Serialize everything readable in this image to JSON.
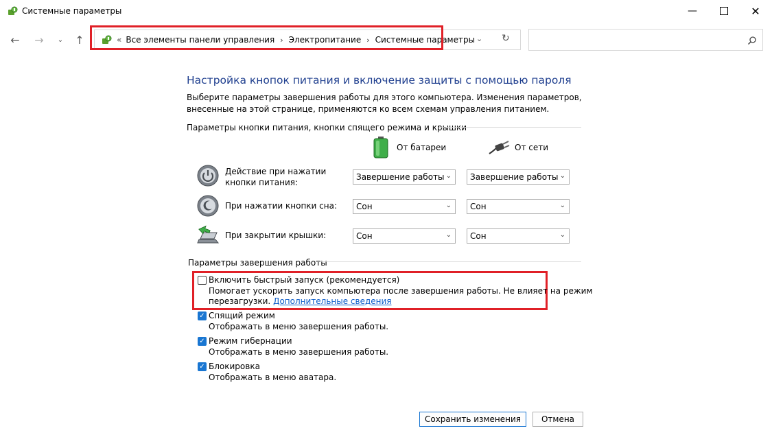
{
  "window": {
    "title": "Системные параметры",
    "minimize_icon": "minimize-icon",
    "maximize_icon": "maximize-icon",
    "close_icon": "close-icon"
  },
  "nav": {
    "breadcrumbs": [
      "Все элементы панели управления",
      "Электропитание",
      "Системные параметры"
    ],
    "overflow": "«",
    "search_placeholder": ""
  },
  "page": {
    "title": "Настройка кнопок питания и включение защиты с помощью пароля",
    "description": "Выберите параметры завершения работы для этого компьютера. Изменения параметров, внесенные на этой странице, применяются ко всем схемам управления питанием."
  },
  "buttons_section": {
    "title": "Параметры кнопки питания, кнопки спящего режима и крышки",
    "col_battery": "От батареи",
    "col_ac": "От сети",
    "rows": [
      {
        "label": "Действие при нажатии кнопки питания:",
        "battery": "Завершение работы",
        "ac": "Завершение работы"
      },
      {
        "label": "При нажатии кнопки сна:",
        "battery": "Сон",
        "ac": "Сон"
      },
      {
        "label": "При закрытии крышки:",
        "battery": "Сон",
        "ac": "Сон"
      }
    ]
  },
  "shutdown_section": {
    "title": "Параметры завершения работы",
    "fast_startup": {
      "label": "Включить быстрый запуск (рекомендуется)",
      "desc1": "Помогает ускорить запуск компьютера после завершения работы. Не влияет на режим",
      "desc2": "перезагрузки.",
      "link": "Дополнительные сведения",
      "checked": false
    },
    "options": [
      {
        "label": "Спящий режим",
        "desc": "Отображать в меню завершения работы.",
        "checked": true
      },
      {
        "label": "Режим гибернации",
        "desc": "Отображать в меню завершения работы.",
        "checked": true
      },
      {
        "label": "Блокировка",
        "desc": "Отображать в меню аватара.",
        "checked": true
      }
    ]
  },
  "footer": {
    "save": "Сохранить изменения",
    "cancel": "Отмена"
  },
  "colors": {
    "highlight": "#e02027",
    "title_blue": "#1f3f8f",
    "checkbox_blue": "#1976d2",
    "link": "#0b5cc9"
  }
}
